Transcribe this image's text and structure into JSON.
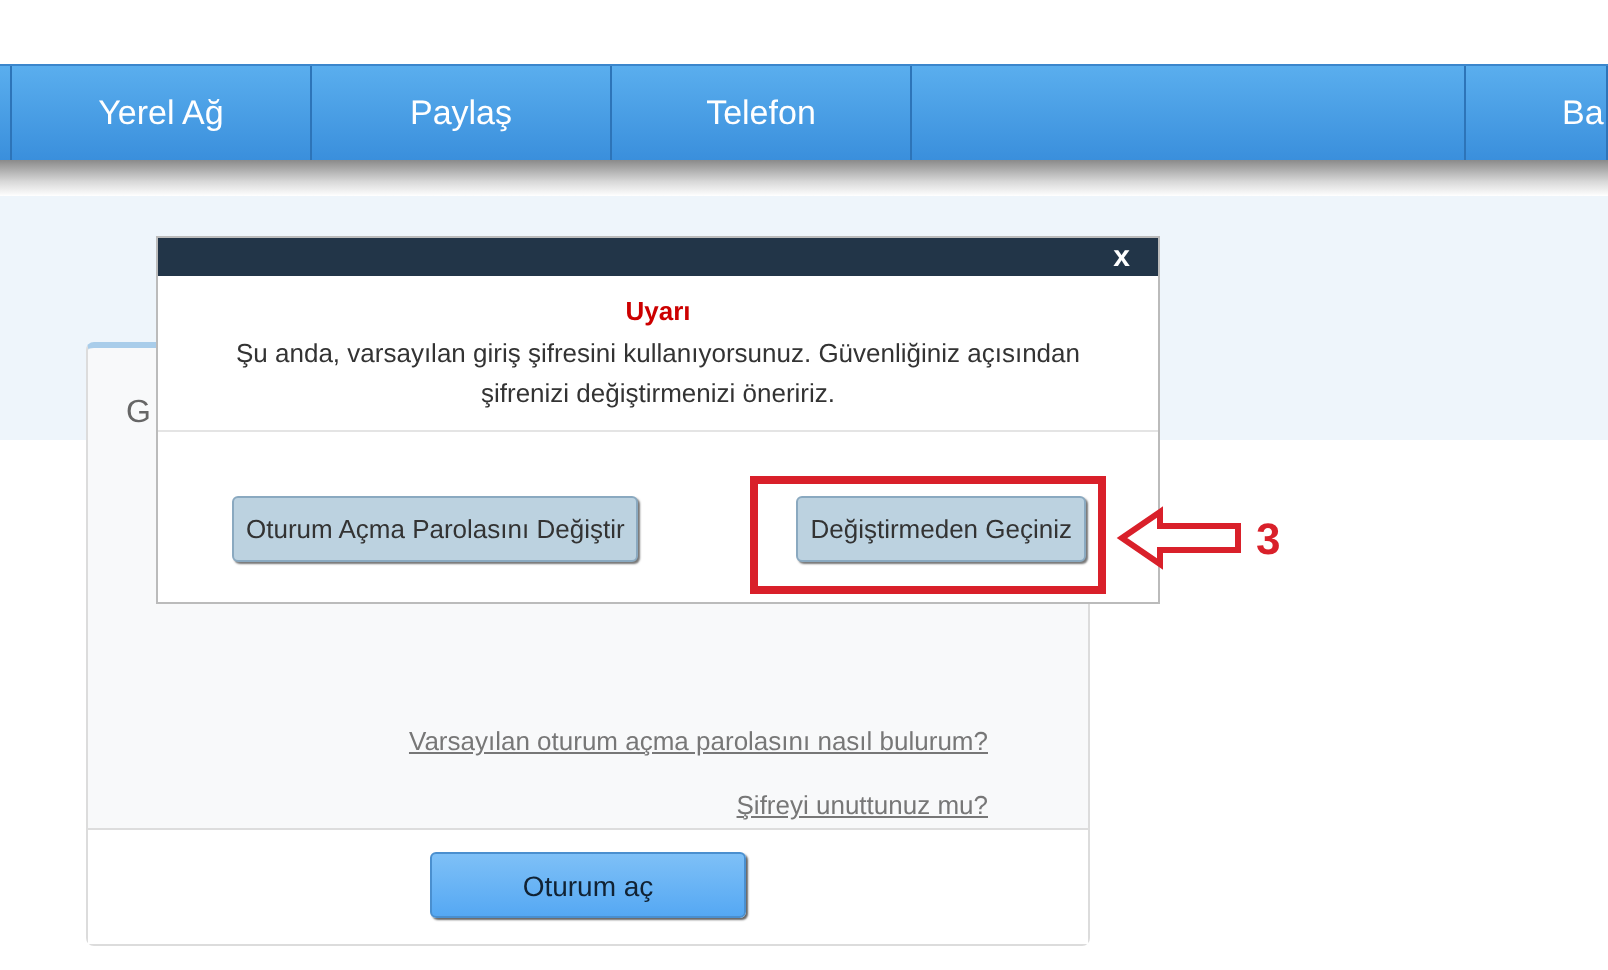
{
  "nav": {
    "tabs": [
      {
        "label": "Yerel Ağ"
      },
      {
        "label": "Paylaş"
      },
      {
        "label": "Telefon"
      },
      {
        "label": "Ba"
      }
    ]
  },
  "login_card": {
    "title": "G",
    "links": [
      "Varsayılan oturum açma parolasını nasıl bulurum?",
      "Şifreyi unuttunuz mu?"
    ],
    "button": "Oturum aç"
  },
  "dialog": {
    "close": "x",
    "heading": "Uyarı",
    "message": "Şu anda, varsayılan giriş şifresini kullanıyorsunuz. Güvenliğiniz açısından şifrenizi değiştirmenizi öneririz.",
    "buttons": [
      "Oturum Açma Parolasını Değiştir",
      "Değiştirmeden Geçiniz"
    ]
  },
  "annotation": {
    "step": "3"
  }
}
